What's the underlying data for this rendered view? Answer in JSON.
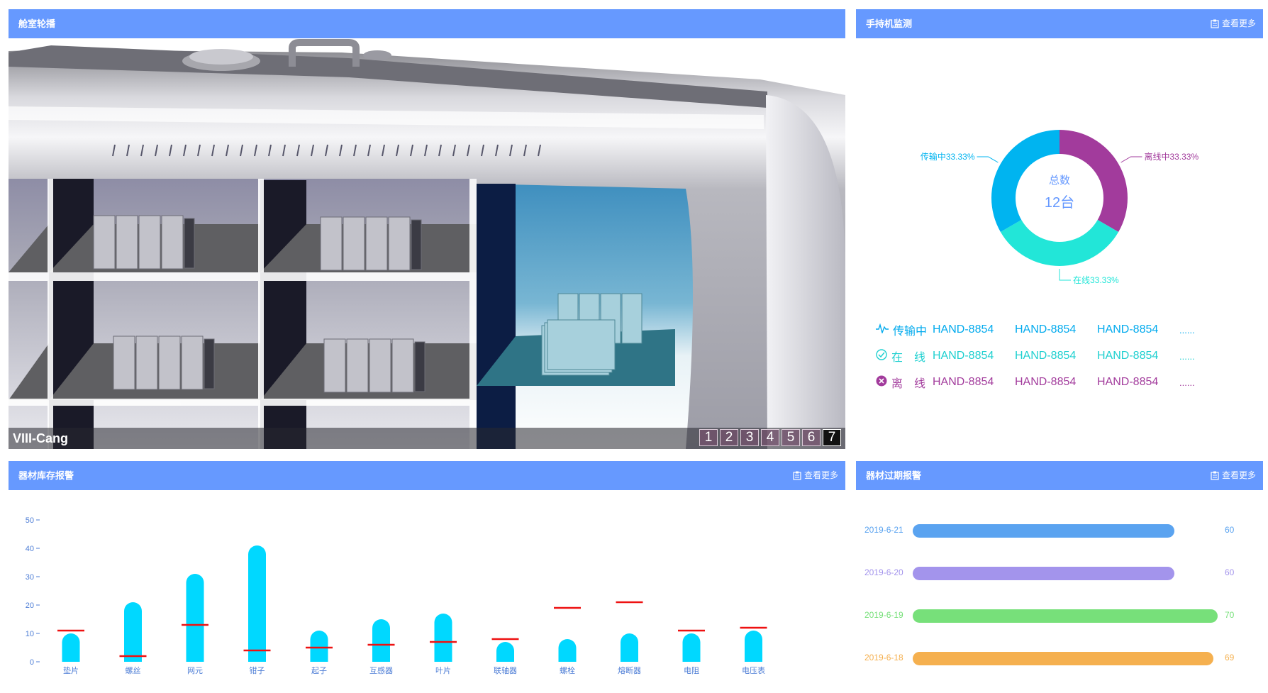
{
  "cabin": {
    "title": "舱室轮播",
    "caption": "VIII-Cang",
    "pages": [
      "1",
      "2",
      "3",
      "4",
      "5",
      "6",
      "7"
    ],
    "active_page": "7"
  },
  "handheld": {
    "title": "手持机监测",
    "more_label": "查看更多",
    "center_label": "总数",
    "center_value": "12台",
    "donut": [
      {
        "name": "传输中",
        "label": "传输中33.33%",
        "percent": 33.33,
        "color": "#00b4f0"
      },
      {
        "name": "离线中",
        "label": "离线中33.33%",
        "percent": 33.33,
        "color": "#a23b9c"
      },
      {
        "name": "在线",
        "label": "在线33.33%",
        "percent": 33.33,
        "color": "#22e6d8"
      }
    ],
    "rows": [
      {
        "label": "传输中",
        "color": "#00aaee",
        "icon": "pulse-icon",
        "devices": [
          "HAND-8854",
          "HAND-8854",
          "HAND-8854"
        ],
        "more": "......"
      },
      {
        "label": "在　线",
        "color": "#1fd0d0",
        "icon": "check-circle-icon",
        "devices": [
          "HAND-8854",
          "HAND-8854",
          "HAND-8854"
        ],
        "more": "......"
      },
      {
        "label": "离　线",
        "color": "#a23b9c",
        "icon": "x-circle-icon",
        "devices": [
          "HAND-8854",
          "HAND-8854",
          "HAND-8854"
        ],
        "more": "......"
      }
    ]
  },
  "stock": {
    "title": "器材库存报警",
    "more_label": "查看更多",
    "chart_data": {
      "type": "bar",
      "categories": [
        "垫片",
        "螺丝",
        "网元",
        "钳子",
        "起子",
        "互感器",
        "叶片",
        "联轴器",
        "螺栓",
        "熔断器",
        "电阻",
        "电压表"
      ],
      "series": [
        {
          "values": [
            10,
            21,
            31,
            41,
            11,
            15,
            17,
            7,
            8,
            10,
            10,
            11
          ],
          "color": "#00d8ff"
        },
        {
          "values": [
            11,
            2,
            13,
            4,
            5,
            6,
            7,
            8,
            19,
            21,
            11,
            12
          ],
          "color": "#ee1111"
        }
      ],
      "yticks": [
        0,
        10,
        20,
        30,
        40,
        50
      ],
      "ylim": [
        0,
        50
      ]
    }
  },
  "expiry": {
    "title": "器材过期报警",
    "more_label": "查看更多",
    "chart_data": {
      "type": "bar",
      "categories": [
        "2019-6-21",
        "2019-6-20",
        "2019-6-19",
        "2019-6-18"
      ],
      "values": [
        60,
        60,
        70,
        69
      ],
      "colors": [
        "#5aa3f0",
        "#a394ec",
        "#77e07a",
        "#f5b04f"
      ],
      "xlim": [
        0,
        70
      ]
    }
  }
}
